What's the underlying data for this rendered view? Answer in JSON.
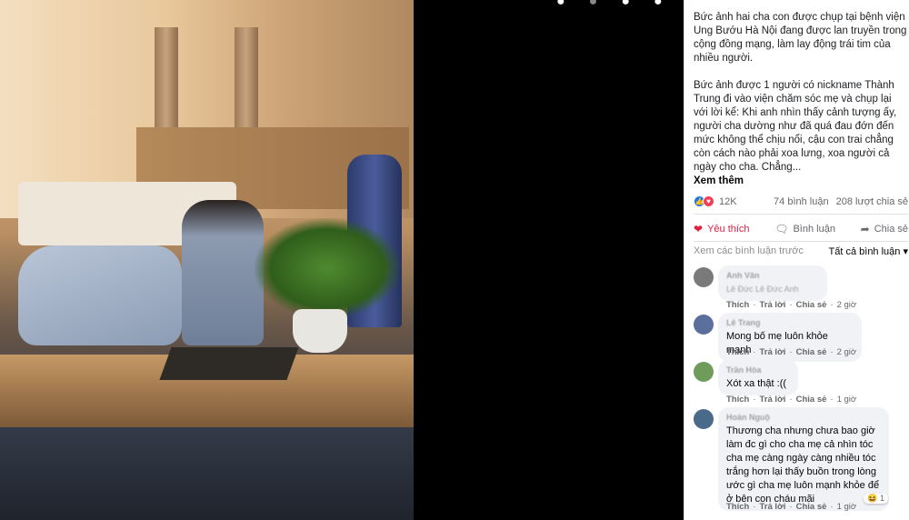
{
  "viewer": {
    "top_icons": [
      "search-icon",
      "zoom-out-icon",
      "tag-icon",
      "fullscreen-icon"
    ]
  },
  "post": {
    "paragraph1": "Bức ảnh hai cha con được chụp tại bệnh viện Ung Bướu Hà Nội đang được lan truyền trong cộng đồng mạng, làm lay động trái tim của nhiều người.",
    "paragraph2": "Bức ảnh được 1 người có nickname Thành Trung đi vào viện chăm sóc mẹ và chụp lại với lời kể: Khi anh nhìn thấy cảnh tượng ấy, người cha dường như đã quá đau đớn đến mức không thể chịu nổi, cậu con trai chẳng còn cách nào phải xoa lưng, xoa người cả ngày cho cha. Chẳng...",
    "see_more": "Xem thêm"
  },
  "stats": {
    "reaction_count": "12K",
    "comments": "74 bình luận",
    "shares": "208 lượt chia sẻ"
  },
  "actions": {
    "like": "Yêu thích",
    "comment": "Bình luận",
    "share": "Chia sẻ"
  },
  "comments_header": {
    "previous": "Xem các bình luận trước",
    "filter": "Tất cả bình luận"
  },
  "comment_actions": {
    "reply": "Trả lời",
    "share": "Chia sẻ"
  },
  "comments": [
    {
      "name": "Anh Vân",
      "text": "Lê Đức Lê Đức Anh",
      "like": "Thích",
      "time": "2 giờ",
      "avatar_color": "#7a7a7a"
    },
    {
      "name": "Lê Trang",
      "text": "Mong bố mẹ luôn khỏe mạnh",
      "like": "Thích",
      "time": "2 giờ",
      "avatar_color": "#5b6f9c"
    },
    {
      "name": "Trần Hòa",
      "text": "Xót xa thật :((",
      "like": "Thích",
      "time": "1 giờ",
      "avatar_color": "#6f9c5b"
    },
    {
      "name": "Hoàn Nguộ",
      "text": "Thương cha nhưng chưa bao giờ làm đc gì cho cha mẹ cả nhìn tóc cha mẹ càng ngày càng nhiều tóc trắng hơn lại thấy buồn trong lòng ước gì cha mẹ luôn mạnh khỏe để ở bên con cháu mãi",
      "like": "Thích",
      "time": "1 giờ",
      "avatar_color": "#4a6a8a",
      "reaction_count": "1"
    }
  ]
}
